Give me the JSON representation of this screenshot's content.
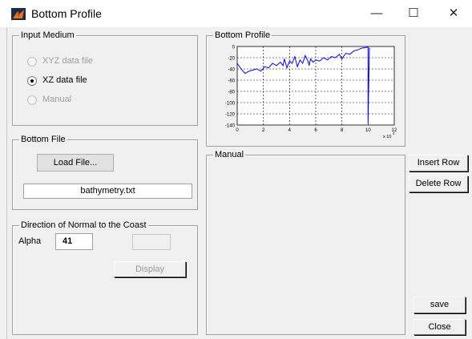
{
  "window": {
    "title": "Bottom Profile",
    "min_symbol": "—",
    "max_symbol": "☐",
    "close_symbol": "✕"
  },
  "input_medium": {
    "title": "Input Medium",
    "options": [
      {
        "label": "XYZ data file",
        "selected": false,
        "enabled": false
      },
      {
        "label": "XZ data file",
        "selected": true,
        "enabled": true
      },
      {
        "label": "Manual",
        "selected": false,
        "enabled": false
      }
    ]
  },
  "bottom_file": {
    "title": "Bottom File",
    "load_label": "Load File...",
    "filename": "bathymetry.txt"
  },
  "direction": {
    "title": "Direction of Normal to the Coast",
    "alpha_label": "Alpha",
    "alpha_value": "41",
    "display_label": "Display"
  },
  "plot_panel": {
    "title": "Bottom Profile"
  },
  "manual_panel": {
    "title": "Manual"
  },
  "buttons": {
    "insert_row": "Insert Row",
    "delete_row": "Delete Row",
    "save": "save",
    "close": "Close"
  },
  "chart_data": {
    "type": "line",
    "title": "",
    "xlabel": "",
    "ylabel": "",
    "xlim": [
      0,
      12
    ],
    "ylim": [
      -140,
      0
    ],
    "x_ticks": [
      "0",
      "2",
      "4",
      "6",
      "8",
      "10",
      "12"
    ],
    "y_ticks": [
      "0",
      "-20",
      "-40",
      "-60",
      "-80",
      "-100",
      "-120",
      "-140"
    ],
    "x_exponent": "x 10",
    "x_exponent_power": "4",
    "grid": true,
    "series": [
      {
        "color": "#0000ff",
        "x": [
          0.0,
          0.3,
          0.6,
          0.9,
          1.2,
          1.5,
          1.8,
          2.1,
          2.4,
          2.7,
          3.0,
          3.3,
          3.5,
          3.6,
          3.8,
          4.0,
          4.2,
          4.4,
          4.6,
          4.8,
          5.0,
          5.2,
          5.4,
          5.5,
          5.6,
          5.8,
          6.0,
          6.3,
          6.6,
          6.9,
          7.2,
          7.5,
          7.8,
          8.0,
          8.3,
          8.6,
          8.9,
          9.2,
          9.5,
          9.8,
          9.9,
          10.0,
          10.0,
          10.05,
          10.1
        ],
        "y": [
          -30,
          -40,
          -48,
          -44,
          -42,
          -40,
          -44,
          -36,
          -38,
          -30,
          -34,
          -28,
          -34,
          -22,
          -38,
          -26,
          -30,
          -18,
          -36,
          -24,
          -30,
          -16,
          -26,
          -34,
          -22,
          -28,
          -24,
          -26,
          -20,
          -24,
          -18,
          -20,
          -14,
          -22,
          -12,
          -14,
          -8,
          -6,
          -3,
          -2,
          -1,
          -2,
          -138,
          -60,
          -2
        ]
      }
    ]
  }
}
